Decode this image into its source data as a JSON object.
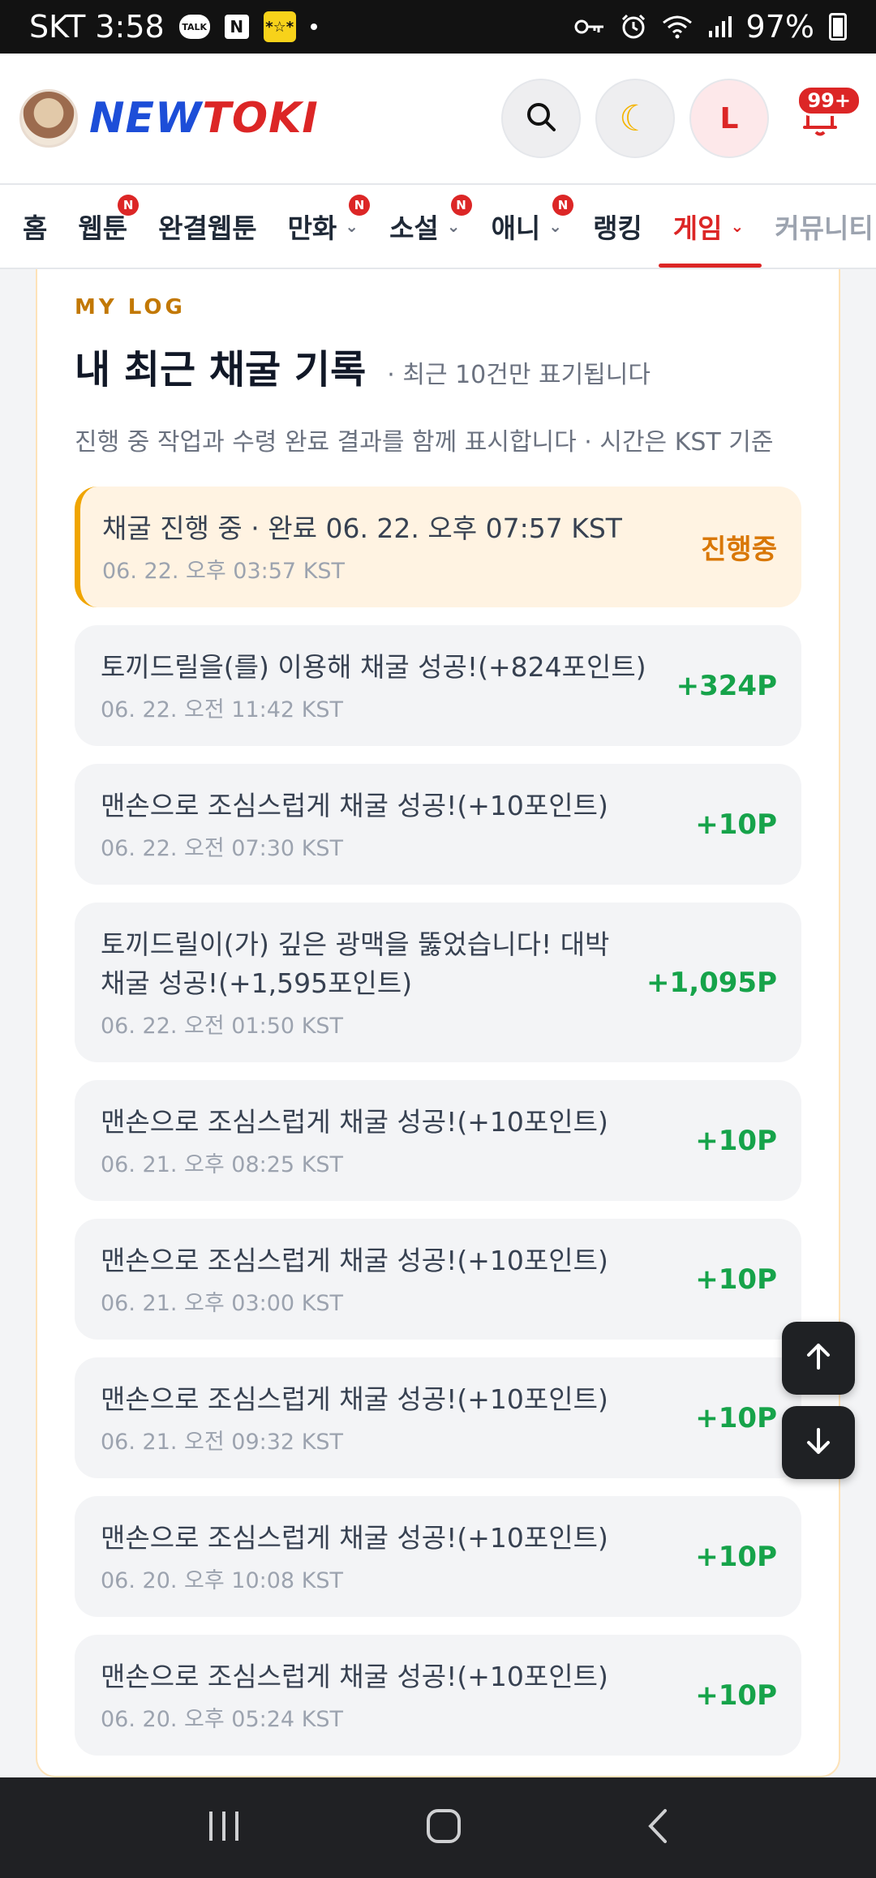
{
  "status_bar": {
    "carrier_time": "SKT 3:58",
    "talk_label": "TALK",
    "n_label": "N",
    "app_label": "*☆*",
    "battery": "97%"
  },
  "header": {
    "logo_part1": "NEW",
    "logo_part2": "TOKI",
    "login_initial": "L",
    "notification_count": "99+"
  },
  "nav": {
    "items": [
      {
        "label": "홈",
        "badge": "",
        "has_dropdown": false
      },
      {
        "label": "웹툰",
        "badge": "N",
        "has_dropdown": false
      },
      {
        "label": "완결웹툰",
        "badge": "",
        "has_dropdown": false
      },
      {
        "label": "만화",
        "badge": "N",
        "has_dropdown": true
      },
      {
        "label": "소설",
        "badge": "N",
        "has_dropdown": true
      },
      {
        "label": "애니",
        "badge": "N",
        "has_dropdown": true
      },
      {
        "label": "랭킹",
        "badge": "",
        "has_dropdown": false
      },
      {
        "label": "게임",
        "badge": "",
        "has_dropdown": true,
        "active": true
      },
      {
        "label": "커뮤니티",
        "badge": "",
        "has_dropdown": false
      }
    ]
  },
  "log_card": {
    "eyebrow": "MY LOG",
    "title": "내 최근 채굴 기록",
    "subnote": "· 최근 10건만 표기됩니다",
    "description": "진행 중 작업과 수령 완료 결과를 함께 표시합니다 · 시간은 KST 기준",
    "entries": [
      {
        "message": "채굴 진행 중 · 완료 06. 22. 오후 07:57 KST",
        "time": "06. 22. 오후 03:57 KST",
        "amount": "진행중",
        "pending": true
      },
      {
        "message": "토끼드릴을(를) 이용해 채굴 성공!(+824포인트)",
        "time": "06. 22. 오전 11:42 KST",
        "amount": "+324P"
      },
      {
        "message": "맨손으로 조심스럽게 채굴 성공!(+10포인트)",
        "time": "06. 22. 오전 07:30 KST",
        "amount": "+10P"
      },
      {
        "message": "토끼드릴이(가) 깊은 광맥을 뚫었습니다! 대박 채굴 성공!(+1,595포인트)",
        "time": "06. 22. 오전 01:50 KST",
        "amount": "+1,095P"
      },
      {
        "message": "맨손으로 조심스럽게 채굴 성공!(+10포인트)",
        "time": "06. 21. 오후 08:25 KST",
        "amount": "+10P"
      },
      {
        "message": "맨손으로 조심스럽게 채굴 성공!(+10포인트)",
        "time": "06. 21. 오후 03:00 KST",
        "amount": "+10P"
      },
      {
        "message": "맨손으로 조심스럽게 채굴 성공!(+10포인트)",
        "time": "06. 21. 오전 09:32 KST",
        "amount": "+10P"
      },
      {
        "message": "맨손으로 조심스럽게 채굴 성공!(+10포인트)",
        "time": "06. 20. 오후 10:08 KST",
        "amount": "+10P"
      },
      {
        "message": "맨손으로 조심스럽게 채굴 성공!(+10포인트)",
        "time": "06. 20. 오후 05:24 KST",
        "amount": "+10P"
      }
    ]
  },
  "colors": {
    "accent_red": "#dc2626",
    "gain_green": "#16a34a",
    "pending_orange": "#d97706",
    "eyebrow_gold": "#c27803"
  }
}
